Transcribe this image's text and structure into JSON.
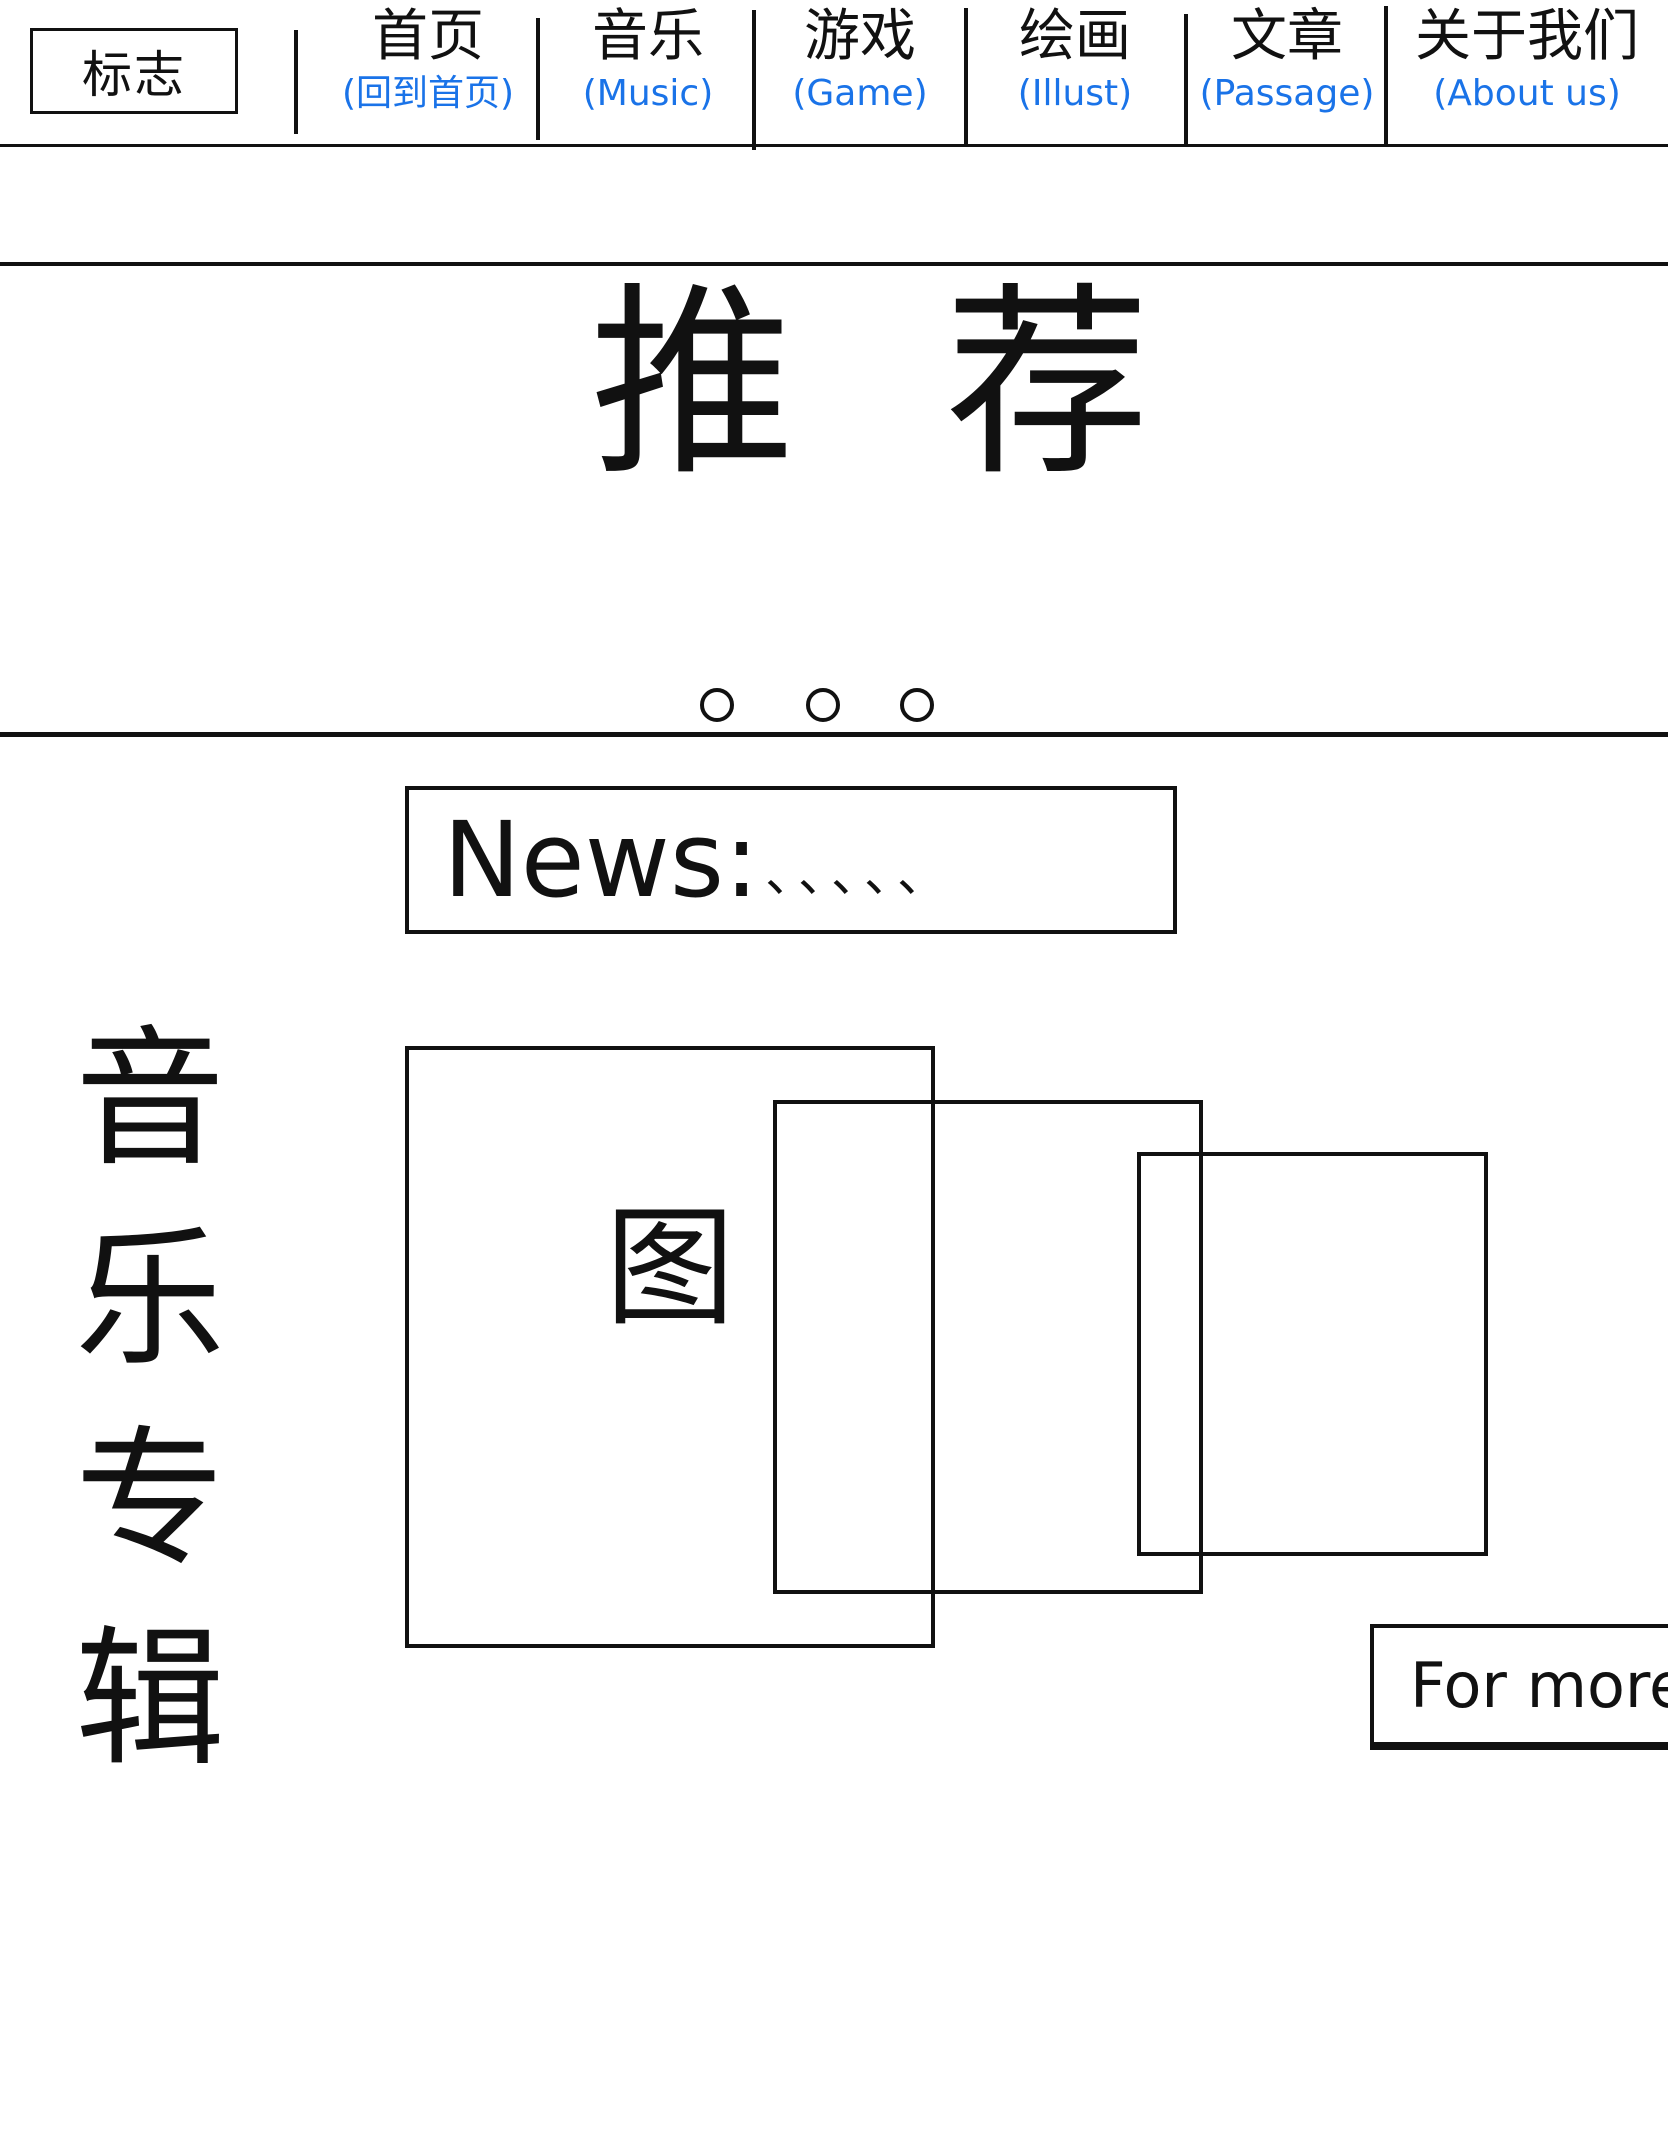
{
  "nav": {
    "logo": "标志",
    "items": [
      {
        "cn": "首页",
        "en": "(回到首页)"
      },
      {
        "cn": "音乐",
        "en": "(Music)"
      },
      {
        "cn": "游戏",
        "en": "(Game)"
      },
      {
        "cn": "绘画",
        "en": "(Illust)"
      },
      {
        "cn": "文章",
        "en": "(Passage)"
      },
      {
        "cn": "关于我们",
        "en": "(About us)"
      }
    ]
  },
  "hero": {
    "title": "推荐"
  },
  "news": {
    "label": "News:",
    "ellipsis": "、、、、、"
  },
  "albums": {
    "section_label_chars": [
      "音",
      "乐",
      "专",
      "辑"
    ],
    "image_placeholder": "图",
    "more_label": "For more"
  },
  "colors": {
    "ink": "#111111",
    "accent": "#1a73e8",
    "background": "#ffffff"
  }
}
